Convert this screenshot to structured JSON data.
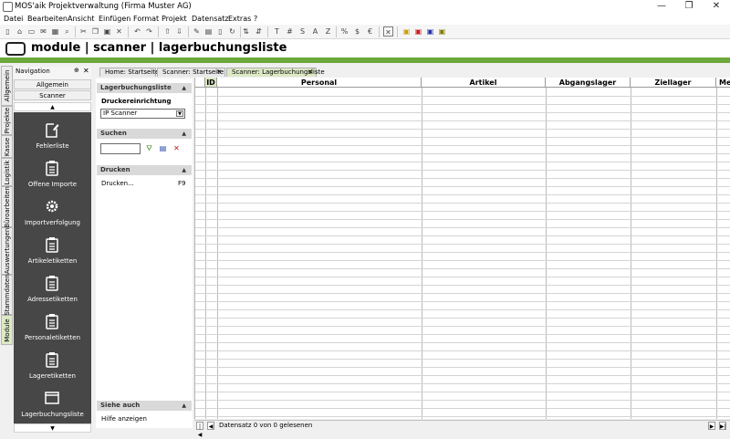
{
  "window": {
    "title": "MOS'aik Projektverwaltung (Firma Muster AG)",
    "minimize": "—",
    "maximize": "❐",
    "close": "✕"
  },
  "menu": [
    "Datei",
    "Bearbeiten",
    "Ansicht",
    "Einfügen",
    "Format",
    "Projekt",
    "Datensatz",
    "Extras",
    "?"
  ],
  "header": {
    "title": "module | scanner | lagerbuchungsliste"
  },
  "navigation": {
    "title": "Navigation",
    "pin": "⊕",
    "close": "✕",
    "group_button": "Allgemein",
    "active_button": "Scanner",
    "scroll_up": "▲",
    "scroll_down": "▼",
    "items": [
      {
        "label": "Fehlerliste",
        "icon": "edit-document-icon"
      },
      {
        "label": "Offene Importe",
        "icon": "clipboard-icon"
      },
      {
        "label": "Importverfolgung",
        "icon": "gear-icon"
      },
      {
        "label": "Artikeletiketten",
        "icon": "clipboard-icon"
      },
      {
        "label": "Adressetiketten",
        "icon": "clipboard-icon"
      },
      {
        "label": "Personaletiketten",
        "icon": "clipboard-icon"
      },
      {
        "label": "Lageretiketten",
        "icon": "clipboard-icon"
      },
      {
        "label": "Lagerbuchungsliste",
        "icon": "window-icon"
      }
    ]
  },
  "vertical_tabs": [
    "Allgemein",
    "Projekte",
    "Kasse",
    "Logistik",
    "Büroarbeiten",
    "Auswertungen",
    "Stammdaten",
    "Module"
  ],
  "doc_tabs": [
    {
      "label": "Home: Startseite",
      "active": false
    },
    {
      "label": "Scanner: Startseite",
      "active": false,
      "close": "✕"
    },
    {
      "label": "Scanner: Lagerbuchungsliste",
      "active": true,
      "close": "✕"
    }
  ],
  "taskpane": {
    "section1": {
      "title": "Lagerbuchungsliste",
      "label": "Druckereinrichtung",
      "printer": "IP Scanner"
    },
    "section2": {
      "title": "Suchen"
    },
    "section3": {
      "title": "Drucken",
      "item": "Drucken...",
      "shortcut": "F9"
    },
    "section4": {
      "title": "Siehe auch",
      "item": "Hilfe anzeigen"
    },
    "collapse": "▲"
  },
  "grid": {
    "columns": [
      "ID",
      "Personal",
      "Artikel",
      "Abgangslager",
      "Ziellager",
      "Me"
    ]
  },
  "status": {
    "text": "Datensatz 0 von 0 gelesenen",
    "first": "|◀",
    "prev": "◀",
    "next": "▶",
    "last": "▶|"
  },
  "toolbar": {
    "letters": [
      "T",
      "#",
      "S",
      "A",
      "Z",
      "%",
      "$",
      "€"
    ]
  },
  "colors": {
    "accent_green": "#6ca83b",
    "active_tab": "#dce9c5",
    "nav_bg": "#474747"
  }
}
